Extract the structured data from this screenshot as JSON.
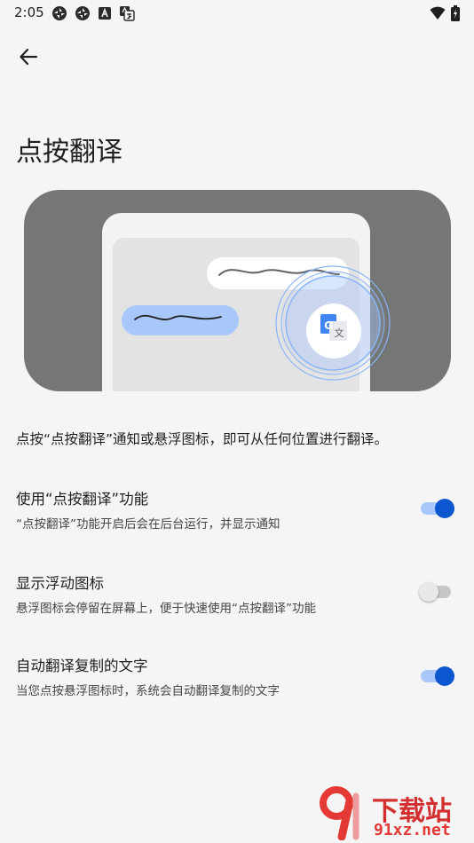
{
  "status_bar": {
    "time": "2:05",
    "left_icons": [
      "sync-icon",
      "sync-icon",
      "accessibility-a-icon",
      "translate-icon"
    ],
    "right_icons": [
      "wifi-icon",
      "battery-charging-icon"
    ]
  },
  "header": {
    "back_icon": "arrow-back-icon"
  },
  "page": {
    "title": "点按翻译",
    "description": "点按“点按翻译”通知或悬浮图标，即可从任何位置进行翻译。"
  },
  "illustration": {
    "bubble_colors": {
      "frame": "#747775",
      "phone": "#f3f3f3",
      "screen": "#e3e3e3",
      "incoming": "#ffffff",
      "outgoing": "#a8c7fa"
    },
    "floating_icon": "google-translate-icon",
    "floating_icon_letters": {
      "left": "G",
      "right": "文"
    }
  },
  "settings": [
    {
      "title": "使用“点按翻译”功能",
      "subtitle": "“点按翻译”功能开启后会在后台运行，并显示通知",
      "enabled": true
    },
    {
      "title": "显示浮动图标",
      "subtitle": "悬浮图标会停留在屏幕上，便于快速使用“点按翻译”功能",
      "enabled": false
    },
    {
      "title": "自动翻译复制的文字",
      "subtitle": "当您点按悬浮图标时，系统会自动翻译复制的文字",
      "enabled": true
    }
  ],
  "colors": {
    "accent": "#0b57d0",
    "accent_track": "#a8c7fa",
    "background": "#f5f5f5"
  },
  "watermark": {
    "main": "下载站",
    "sub": "91xz.net"
  }
}
